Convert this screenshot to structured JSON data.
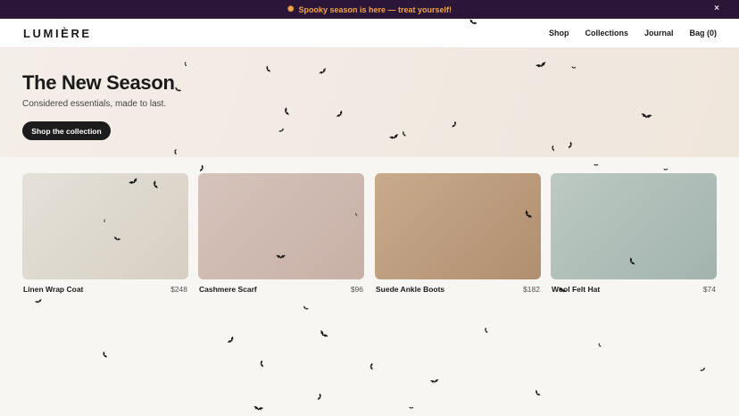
{
  "promo": {
    "sparkle": "✺",
    "text": "Spooky season is here — treat yourself!",
    "close": "×"
  },
  "nav": {
    "logo": "LUMIÈRE",
    "links": [
      "Shop",
      "Collections",
      "Journal",
      "Bag (0)"
    ]
  },
  "hero": {
    "title": "The New Season",
    "subtitle": "Considered essentials, made to last.",
    "cta": "Shop the collection"
  },
  "products": [
    {
      "name": "Linen Wrap Coat",
      "price": "$248"
    },
    {
      "name": "Cashmere Scarf",
      "price": "$96"
    },
    {
      "name": "Suede Ankle Boots",
      "price": "$182"
    },
    {
      "name": "Wool Felt Hat",
      "price": "$74"
    }
  ],
  "overlay": {
    "icon": "bat-icon",
    "color": "#1a1a1a"
  }
}
